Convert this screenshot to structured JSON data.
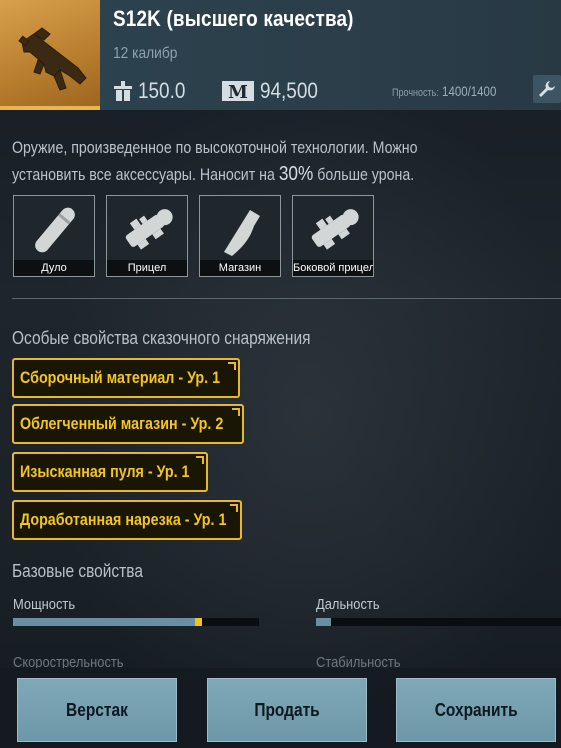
{
  "item": {
    "name": "S12K (высшего качества)",
    "caliber": "12 калибр",
    "weight": "150.0",
    "price": "94,500",
    "durability_label": "Прочность:",
    "durability_value": "1400/1400"
  },
  "description": {
    "line1": "Оружие, произведенное по высокоточной технологии. Можно",
    "line2_prefix": "установить все аксессуары. Наносит на ",
    "line2_pct": "30%",
    "line2_suffix": " больше урона."
  },
  "attachments": [
    {
      "label": "Дуло",
      "icon": "muzzle-icon"
    },
    {
      "label": "Прицел",
      "icon": "scope-icon"
    },
    {
      "label": "Магазин",
      "icon": "magazine-icon"
    },
    {
      "label": "Боковой прицел",
      "icon": "side-scope-icon"
    }
  ],
  "legendary": {
    "title": "Особые свойства сказочного снаряжения",
    "props": [
      "Сборочный материал - Ур. 1",
      "Облегченный магазин - Ур. 2",
      "Изысканная пуля - Ур. 1",
      "Доработанная нарезка - Ур. 1"
    ]
  },
  "base": {
    "title": "Базовые свойства",
    "stats": [
      {
        "label": "Мощность",
        "value": 0.74,
        "marker": 0.74
      },
      {
        "label": "Дальность",
        "value": 0.06
      },
      {
        "label": "Скорострельность"
      },
      {
        "label": "Стабильность"
      }
    ]
  },
  "buttons": {
    "workbench": "Верстак",
    "sell": "Продать",
    "save": "Сохранить"
  },
  "colors": {
    "accent_gold": "#e7b92a",
    "button_bg": "#7fa8b7",
    "bar_fill": "#6a8fa0"
  }
}
